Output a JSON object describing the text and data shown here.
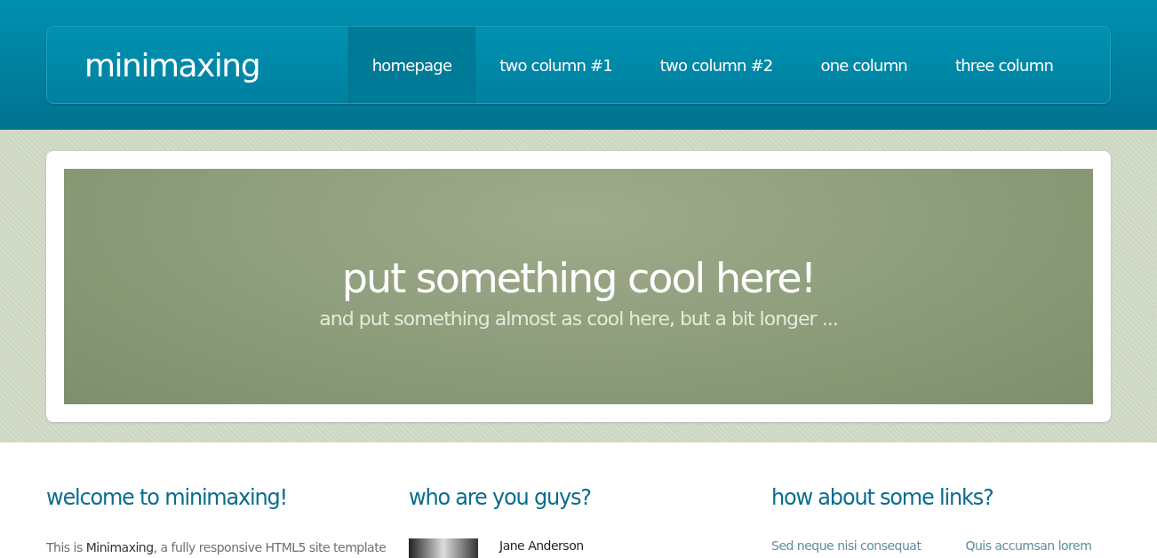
{
  "logo": "minimaxing",
  "nav": [
    {
      "label": "homepage",
      "selected": true
    },
    {
      "label": "two column #1",
      "selected": false
    },
    {
      "label": "two column #2",
      "selected": false
    },
    {
      "label": "one column",
      "selected": false
    },
    {
      "label": "three column",
      "selected": false
    }
  ],
  "banner": {
    "title": "put something cool here!",
    "subtitle": "and put something almost as cool here, but a bit longer ..."
  },
  "columns": [
    {
      "heading": "welcome to minimaxing!",
      "kind": "text",
      "text": "This is **Minimaxing**, a fully responsive HTML5 site template"
    },
    {
      "heading": "who are you guys?",
      "kind": "person",
      "name": "Jane Anderson"
    },
    {
      "heading": "how about some links?",
      "kind": "links",
      "links": [
        "Sed neque nisi consequat",
        "Quis accumsan lorem"
      ]
    }
  ]
}
